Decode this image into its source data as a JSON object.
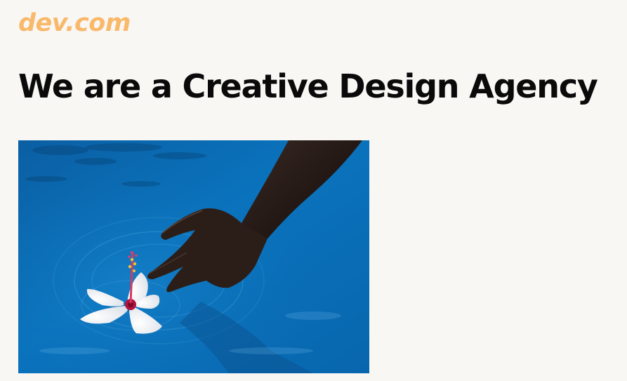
{
  "header": {
    "logo_text": "dev.com"
  },
  "hero": {
    "headline": "We are a Creative Design Agency",
    "image_subject": "hand-touching-water-with-hibiscus-flower"
  },
  "colors": {
    "background": "#f9f7f4",
    "logo": "#f9b96b",
    "headline": "#0a0a0a",
    "water": "#0a6fb8"
  }
}
